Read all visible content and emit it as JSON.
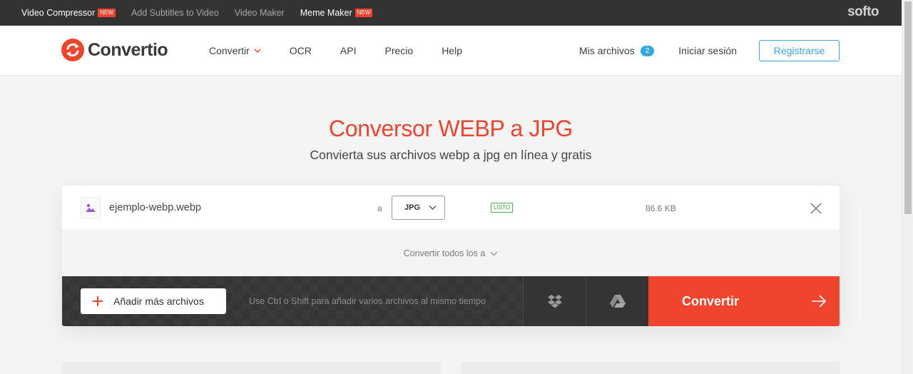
{
  "softo_bar": {
    "items": [
      {
        "label": "Video Compressor",
        "badge": "NEW",
        "dim": false
      },
      {
        "label": "Add Subtitles to Video",
        "badge": "",
        "dim": true
      },
      {
        "label": "Video Maker",
        "badge": "",
        "dim": true
      },
      {
        "label": "Meme Maker",
        "badge": "NEW",
        "dim": false
      }
    ],
    "logo": "softo"
  },
  "header": {
    "brand": "Convertio",
    "nav": [
      {
        "label": "Convertir",
        "dropdown": true
      },
      {
        "label": "OCR",
        "dropdown": false
      },
      {
        "label": "API",
        "dropdown": false
      },
      {
        "label": "Precio",
        "dropdown": false
      },
      {
        "label": "Help",
        "dropdown": false
      }
    ],
    "my_files_label": "Mis archivos",
    "my_files_count": "2",
    "login_label": "Iniciar sesión",
    "register_label": "Registrarse"
  },
  "hero": {
    "title": "Conversor WEBP a JPG",
    "subtitle": "Convierta sus archivos webp a jpg en línea y gratis"
  },
  "file": {
    "name": "ejemplo-webp.webp",
    "to_label": "a",
    "format": "JPG",
    "status": "LISTO",
    "size": "86.6 KB"
  },
  "converter": {
    "convert_all_label": "Convertir todos los a",
    "add_more_label": "Añadir más archivos",
    "hint": "Use Ctrl o Shift para añadir varios archivos al mismo tiempo",
    "convert_label": "Convertir"
  },
  "colors": {
    "brand_red": "#f0442e",
    "accent_blue": "#35a8de",
    "status_green": "#4caf50",
    "top_bar": "#333333"
  }
}
